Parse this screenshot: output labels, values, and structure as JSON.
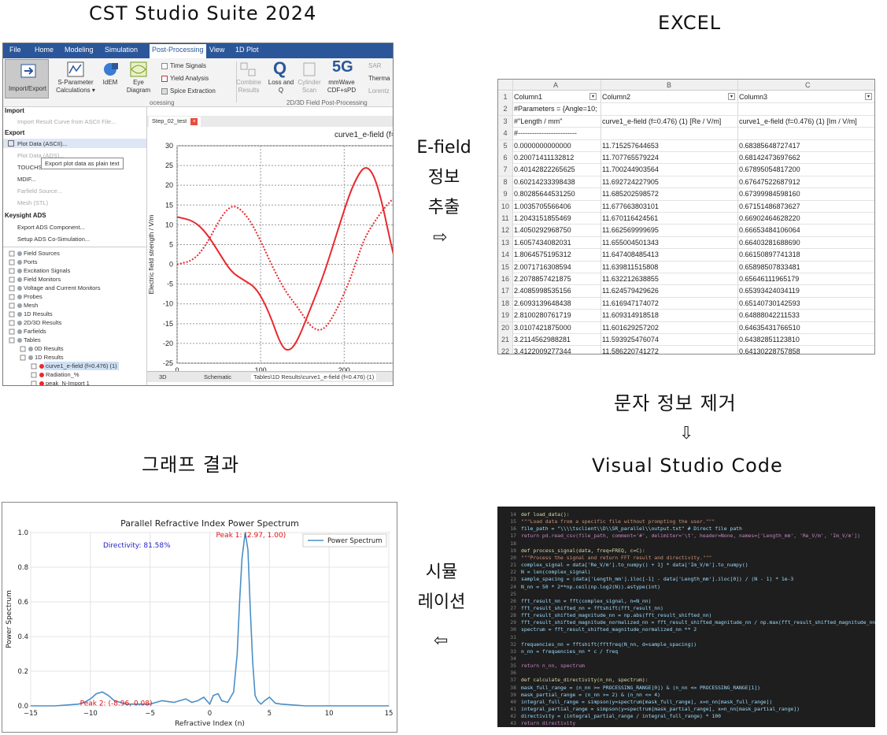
{
  "captions": {
    "cst": "CST  Studio  Suite  2024",
    "excel": "EXCEL",
    "graph": "그래프  결과",
    "vscode": "Visual  Studio  Code"
  },
  "arrows": {
    "extract": [
      "E-field",
      "정보",
      "추출"
    ],
    "extract_glyph": "⇨",
    "remove": "문자  정보  제거",
    "remove_glyph": "⇩",
    "simulate": [
      "시뮬",
      "레이션"
    ],
    "simulate_glyph": "⇦"
  },
  "cst": {
    "menu": [
      "File",
      "Home",
      "Modeling",
      "Simulation",
      "Post-Processing",
      "View",
      "1D Plot"
    ],
    "active_menu": "Post-Processing",
    "ribbon": {
      "import_export": "Import/Export",
      "sparam": "S-Parameter\nCalculations ▾",
      "idem": "IdEM",
      "eye": "Eye\nDiagram",
      "time_signals": "Time Signals",
      "yield": "Yield Analysis",
      "spice": "Spice Extraction",
      "combine": "Combine\nResults",
      "loss": "Loss and\nQ",
      "cylinder": "Cylinder\nScan",
      "mmwave": "mmWave\nCDF+sPD",
      "sar": "SAR",
      "thermal": "Therma",
      "lorentz": "Lorentz",
      "group_processing": "ocessing",
      "group_field": "2D/3D Field Post-Processing"
    },
    "menu_import_header": "Import",
    "menu_import_item": "Import Result Curve from ASCII File...",
    "menu_export_header": "Export",
    "menu_export_items": [
      "Plot Data (ASCII)...",
      "Plot Data (ADS)...",
      "TOUCHSTONE...",
      "MDIF...",
      "Farfield Source...",
      "Mesh (STL)"
    ],
    "tooltip": "Export plot data as plain text",
    "keysight_header": "Keysight ADS",
    "keysight_items": [
      "Export ADS Component...",
      "Setup ADS Co-Simulation..."
    ],
    "tree": [
      "Field Sources",
      "Ports",
      "Excitation Signals",
      "Field Monitors",
      "Voltage and Current Monitors",
      "Probes",
      "Mesh",
      "1D Results",
      "2D/3D Results",
      "Farfields",
      "Tables",
      "0D Results",
      "1D Results",
      "curve1_e-field (f=0.476) (1)",
      "Radiation_%",
      "peak_N-Import 1"
    ],
    "tab": "Step_02_test",
    "plot_title": "curve1_e-field (f=",
    "ylabel": "Electric field strength / V/m",
    "bottom_tabs": [
      "3D",
      "Schematic",
      "Tables\\1D Results\\curve1_e-field (f=0.476) (1)"
    ]
  },
  "excel": {
    "col_letters": [
      "A",
      "B",
      "C"
    ],
    "header": [
      "Column1",
      "Column2",
      "Column3"
    ],
    "row2": "#Parameters = {Angle=10;",
    "row3": [
      "#\"Length / mm\"",
      "curve1_e-field (f=0.476) (1) [Re / V/m]",
      "curve1_e-field (f=0.476) (1) [Im / V/m]"
    ],
    "row4": "#-------------------------",
    "rows": [
      [
        "0.0000000000000",
        "11.715257644653",
        "0.68385648727417"
      ],
      [
        "0.20071411132812",
        "11.707765579224",
        "0.68142473697662"
      ],
      [
        "0.40142822265625",
        "11.700244903564",
        "0.67895054817200"
      ],
      [
        "0.60214233398438",
        "11.692724227905",
        "0.67647522687912"
      ],
      [
        "0.80285644531250",
        "11.685202598572",
        "0.67399984598160"
      ],
      [
        "1.0035705566406",
        "11.677663803101",
        "0.67151486873627"
      ],
      [
        "1.2043151855469",
        "11.670116424561",
        "0.66902464628220"
      ],
      [
        "1.4050292968750",
        "11.662569999695",
        "0.66653484106064"
      ],
      [
        "1.6057434082031",
        "11.655004501343",
        "0.66403281688690"
      ],
      [
        "1.8064575195312",
        "11.647408485413",
        "0.66150897741318"
      ],
      [
        "2.0071716308594",
        "11.639811515808",
        "0.65898507833481"
      ],
      [
        "2.2078857421875",
        "11.632212638855",
        "0.65646111965179"
      ],
      [
        "2.4085998535156",
        "11.624579429626",
        "0.65393424034119"
      ],
      [
        "2.6093139648438",
        "11.616947174072",
        "0.65140730142593"
      ],
      [
        "2.8100280761719",
        "11.609314918518",
        "0.64888042211533"
      ],
      [
        "3.0107421875000",
        "11.601629257202",
        "0.64635431766510"
      ],
      [
        "3.2114562988281",
        "11.593925476074",
        "0.64382851123810"
      ],
      [
        "3.4122009277344",
        "11.586220741272",
        "0.64130228757858"
      ],
      [
        "3.6129150390625",
        "11.578492164612",
        "0.63877600431442"
      ]
    ]
  },
  "vscode": {
    "start_line": 14,
    "lines": [
      "def load_data():",
      "    \"\"\"Load data from a specific file without prompting the user.\"\"\"",
      "    file_path = \"\\\\\\\\tsclient\\\\D\\\\SR_parallel\\\\output.txt\"  # Direct file path",
      "    return pd.read_csv(file_path, comment='#', delimiter='\\t', header=None, names=['Length_mm', 'Re_V/m', 'Im_V/m'])",
      "",
      "def process_signal(data, freq=FREQ, c=C):",
      "    \"\"\"Process the signal and return FFT result and directivity.\"\"\"",
      "    complex_signal = data['Re_V/m'].to_numpy() + 1j * data['Im_V/m'].to_numpy()",
      "    N = len(complex_signal)",
      "    sample_spacing = (data['Length_mm'].iloc[-1] - data['Length_mm'].iloc[0]) / (N - 1) * 1e-3",
      "    N_nn = 50 * 2**np.ceil(np.log2(N)).astype(int)",
      "",
      "    fft_result_nn = fft(complex_signal, n=N_nn)",
      "    fft_result_shifted_nn = fftshift(fft_result_nn)",
      "    fft_result_shifted_magnitude_nn = np.abs(fft_result_shifted_nn)",
      "    fft_result_shifted_magnitude_normalized_nn = fft_result_shifted_magnitude_nn / np.max(fft_result_shifted_magnitude_nn)",
      "    spectrum = fft_result_shifted_magnitude_normalized_nn ** 2",
      "",
      "    frequencies_nn = fftshift(fftfreq(N_nn, d=sample_spacing))",
      "    n_nn = frequencies_nn * c / freq",
      "",
      "    return n_nn, spectrum",
      "",
      "def calculate_directivity(n_nn, spectrum):",
      "    mask_full_range = (n_nn >= PROCESSING_RANGE[0]) & (n_nn <= PROCESSING_RANGE[1])",
      "    mask_partial_range = (n_nn >= 2) & (n_nn <= 4)",
      "    integral_full_range = simpson(y=spectrum[mask_full_range], x=n_nn[mask_full_range])",
      "    integral_partial_range = simpson(y=spectrum[mask_partial_range], x=n_nn[mask_partial_range])",
      "    directivity = (integral_partial_range / integral_full_range) * 100",
      "    return directivity"
    ]
  },
  "chart_data": [
    {
      "type": "line",
      "panel": "cst",
      "title": "curve1_e-field (f=",
      "ylabel": "Electric field strength / V/m",
      "xlim": [
        0,
        260
      ],
      "ylim": [
        -25,
        30
      ],
      "xticks": [
        0,
        100,
        200
      ],
      "yticks": [
        30,
        25,
        20,
        15,
        10,
        5,
        0,
        -5,
        -10,
        -15,
        -20,
        -25
      ],
      "series": [
        {
          "style": "solid",
          "x": [
            0,
            20,
            35,
            50,
            65,
            80,
            95,
            110,
            125,
            135,
            145,
            160,
            175,
            190,
            205,
            215,
            225,
            235,
            245,
            255,
            262
          ],
          "y": [
            12,
            11,
            8,
            3,
            -2,
            -4,
            -6,
            -12,
            -21,
            -22,
            -19,
            -11,
            -3,
            7,
            17,
            22,
            25,
            23,
            16,
            6,
            0
          ]
        },
        {
          "style": "dotted",
          "x": [
            0,
            20,
            35,
            50,
            60,
            70,
            85,
            100,
            115,
            130,
            145,
            160,
            175,
            190,
            205,
            215,
            225,
            240,
            255,
            262
          ],
          "y": [
            0,
            1,
            5,
            11,
            14,
            15,
            12,
            6,
            -1,
            -7,
            -11,
            -16,
            -17,
            -12,
            -5,
            1,
            7,
            12,
            16,
            17
          ]
        }
      ]
    },
    {
      "type": "line",
      "panel": "graph",
      "title": "Parallel Refractive Index Power Spectrum",
      "xlabel": "Refractive Index (n)",
      "ylabel": "Power Spectrum",
      "xlim": [
        -15,
        15
      ],
      "ylim": [
        0,
        1.0
      ],
      "xticks": [
        -15,
        -10,
        -5,
        0,
        5,
        10,
        15
      ],
      "yticks": [
        0.0,
        0.2,
        0.4,
        0.6,
        0.8,
        1.0
      ],
      "grid": true,
      "legend": "top-right",
      "series": [
        {
          "name": "Power Spectrum",
          "x": [
            -15,
            -13,
            -12,
            -11,
            -10.5,
            -10,
            -9.5,
            -9,
            -8.5,
            -8,
            -7.5,
            -7,
            -6,
            -5,
            -4,
            -3,
            -2,
            -1.5,
            -1,
            -0.5,
            0,
            0.3,
            0.7,
            1,
            1.5,
            2,
            2.3,
            2.5,
            2.7,
            2.97,
            3.2,
            3.4,
            3.6,
            3.8,
            4,
            4.3,
            4.6,
            5,
            5.5,
            6,
            7,
            8,
            10,
            12,
            15
          ],
          "y": [
            0,
            0,
            0.005,
            0.01,
            0.02,
            0.04,
            0.07,
            0.08,
            0.06,
            0.03,
            0.02,
            0.01,
            0.01,
            0.01,
            0.03,
            0.02,
            0.04,
            0.02,
            0.03,
            0.05,
            0.01,
            0.06,
            0.07,
            0.03,
            0.02,
            0.08,
            0.3,
            0.6,
            0.85,
            1.0,
            0.9,
            0.55,
            0.25,
            0.06,
            0.03,
            0.01,
            0.03,
            0.05,
            0.015,
            0.01,
            0.005,
            0,
            0,
            0,
            0
          ]
        }
      ],
      "annotations": [
        {
          "text": "Directivity: 81.58%",
          "color": "#1f1fcc"
        },
        {
          "text": "Peak 1: (2.97, 1.00)",
          "color": "#e01010",
          "x": 2.97,
          "y": 1.0
        },
        {
          "text": "Peak 2: (-8.96, 0.08)",
          "color": "#e01010",
          "x": -8.96,
          "y": 0.08
        }
      ]
    }
  ],
  "colors": {
    "cst_menu": "#2b579a",
    "cst_curve": "#e8292e",
    "spectrum_line": "#4a8fc8",
    "vscode_bg": "#1e1e1e"
  }
}
